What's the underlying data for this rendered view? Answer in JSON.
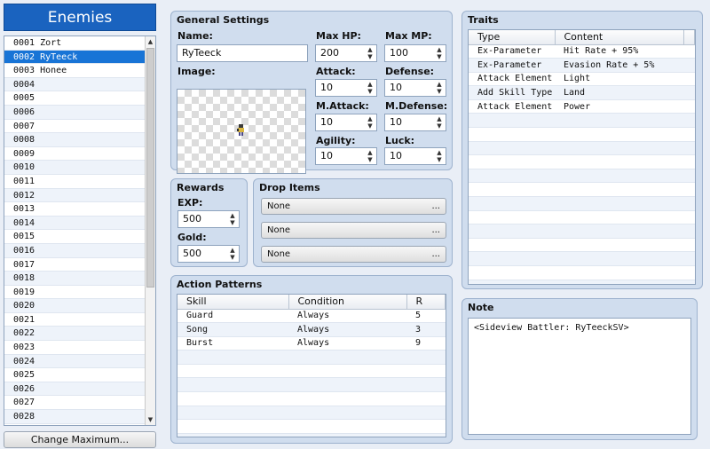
{
  "enemies": {
    "header": "Enemies",
    "items": [
      "0001 Zort",
      "0002 RyTeeck",
      "0003 Honee",
      "0004",
      "0005",
      "0006",
      "0007",
      "0008",
      "0009",
      "0010",
      "0011",
      "0012",
      "0013",
      "0014",
      "0015",
      "0016",
      "0017",
      "0018",
      "0019",
      "0020",
      "0021",
      "0022",
      "0023",
      "0024",
      "0025",
      "0026",
      "0027",
      "0028"
    ],
    "selected_index": 1,
    "change_max_label": "Change Maximum..."
  },
  "general": {
    "title": "General Settings",
    "name_label": "Name:",
    "name_value": "RyTeeck",
    "image_label": "Image:",
    "max_hp_label": "Max HP:",
    "max_hp": "200",
    "max_mp_label": "Max MP:",
    "max_mp": "100",
    "attack_label": "Attack:",
    "attack": "10",
    "defense_label": "Defense:",
    "defense": "10",
    "mattack_label": "M.Attack:",
    "mattack": "10",
    "mdefense_label": "M.Defense:",
    "mdefense": "10",
    "agility_label": "Agility:",
    "agility": "10",
    "luck_label": "Luck:",
    "luck": "10"
  },
  "rewards": {
    "title": "Rewards",
    "exp_label": "EXP:",
    "exp": "500",
    "gold_label": "Gold:",
    "gold": "500"
  },
  "drop_items": {
    "title": "Drop Items",
    "items": [
      "None",
      "None",
      "None"
    ],
    "button_glyph": "..."
  },
  "action_patterns": {
    "title": "Action Patterns",
    "columns": [
      "Skill",
      "Condition",
      "R"
    ],
    "rows": [
      [
        "Guard",
        "Always",
        "5"
      ],
      [
        "Song",
        "Always",
        "3"
      ],
      [
        "Burst",
        "Always",
        "9"
      ],
      [
        "",
        "",
        ""
      ],
      [
        "",
        "",
        ""
      ],
      [
        "",
        "",
        ""
      ],
      [
        "",
        "",
        ""
      ],
      [
        "",
        "",
        ""
      ],
      [
        "",
        "",
        ""
      ],
      [
        "",
        "",
        ""
      ]
    ]
  },
  "traits": {
    "title": "Traits",
    "columns": [
      "Type",
      "Content"
    ],
    "rows": [
      [
        "Ex-Parameter",
        "Hit Rate + 95%"
      ],
      [
        "Ex-Parameter",
        "Evasion Rate + 5%"
      ],
      [
        "Attack Element",
        "Light"
      ],
      [
        "Add Skill Type",
        "Land"
      ],
      [
        "Attack Element",
        "Power"
      ]
    ],
    "empty_rows": 13
  },
  "note": {
    "title": "Note",
    "text": "<Sideview Battler: RyTeeckSV>"
  },
  "colors": {
    "accent": "#1874d6",
    "header_blue": "#1a63bf",
    "panel": "#d0ddee",
    "background": "#e9eef6"
  },
  "icons": {
    "spin_up": "triangle-up",
    "spin_down": "triangle-down",
    "ellipsis": "ellipsis-icon"
  }
}
